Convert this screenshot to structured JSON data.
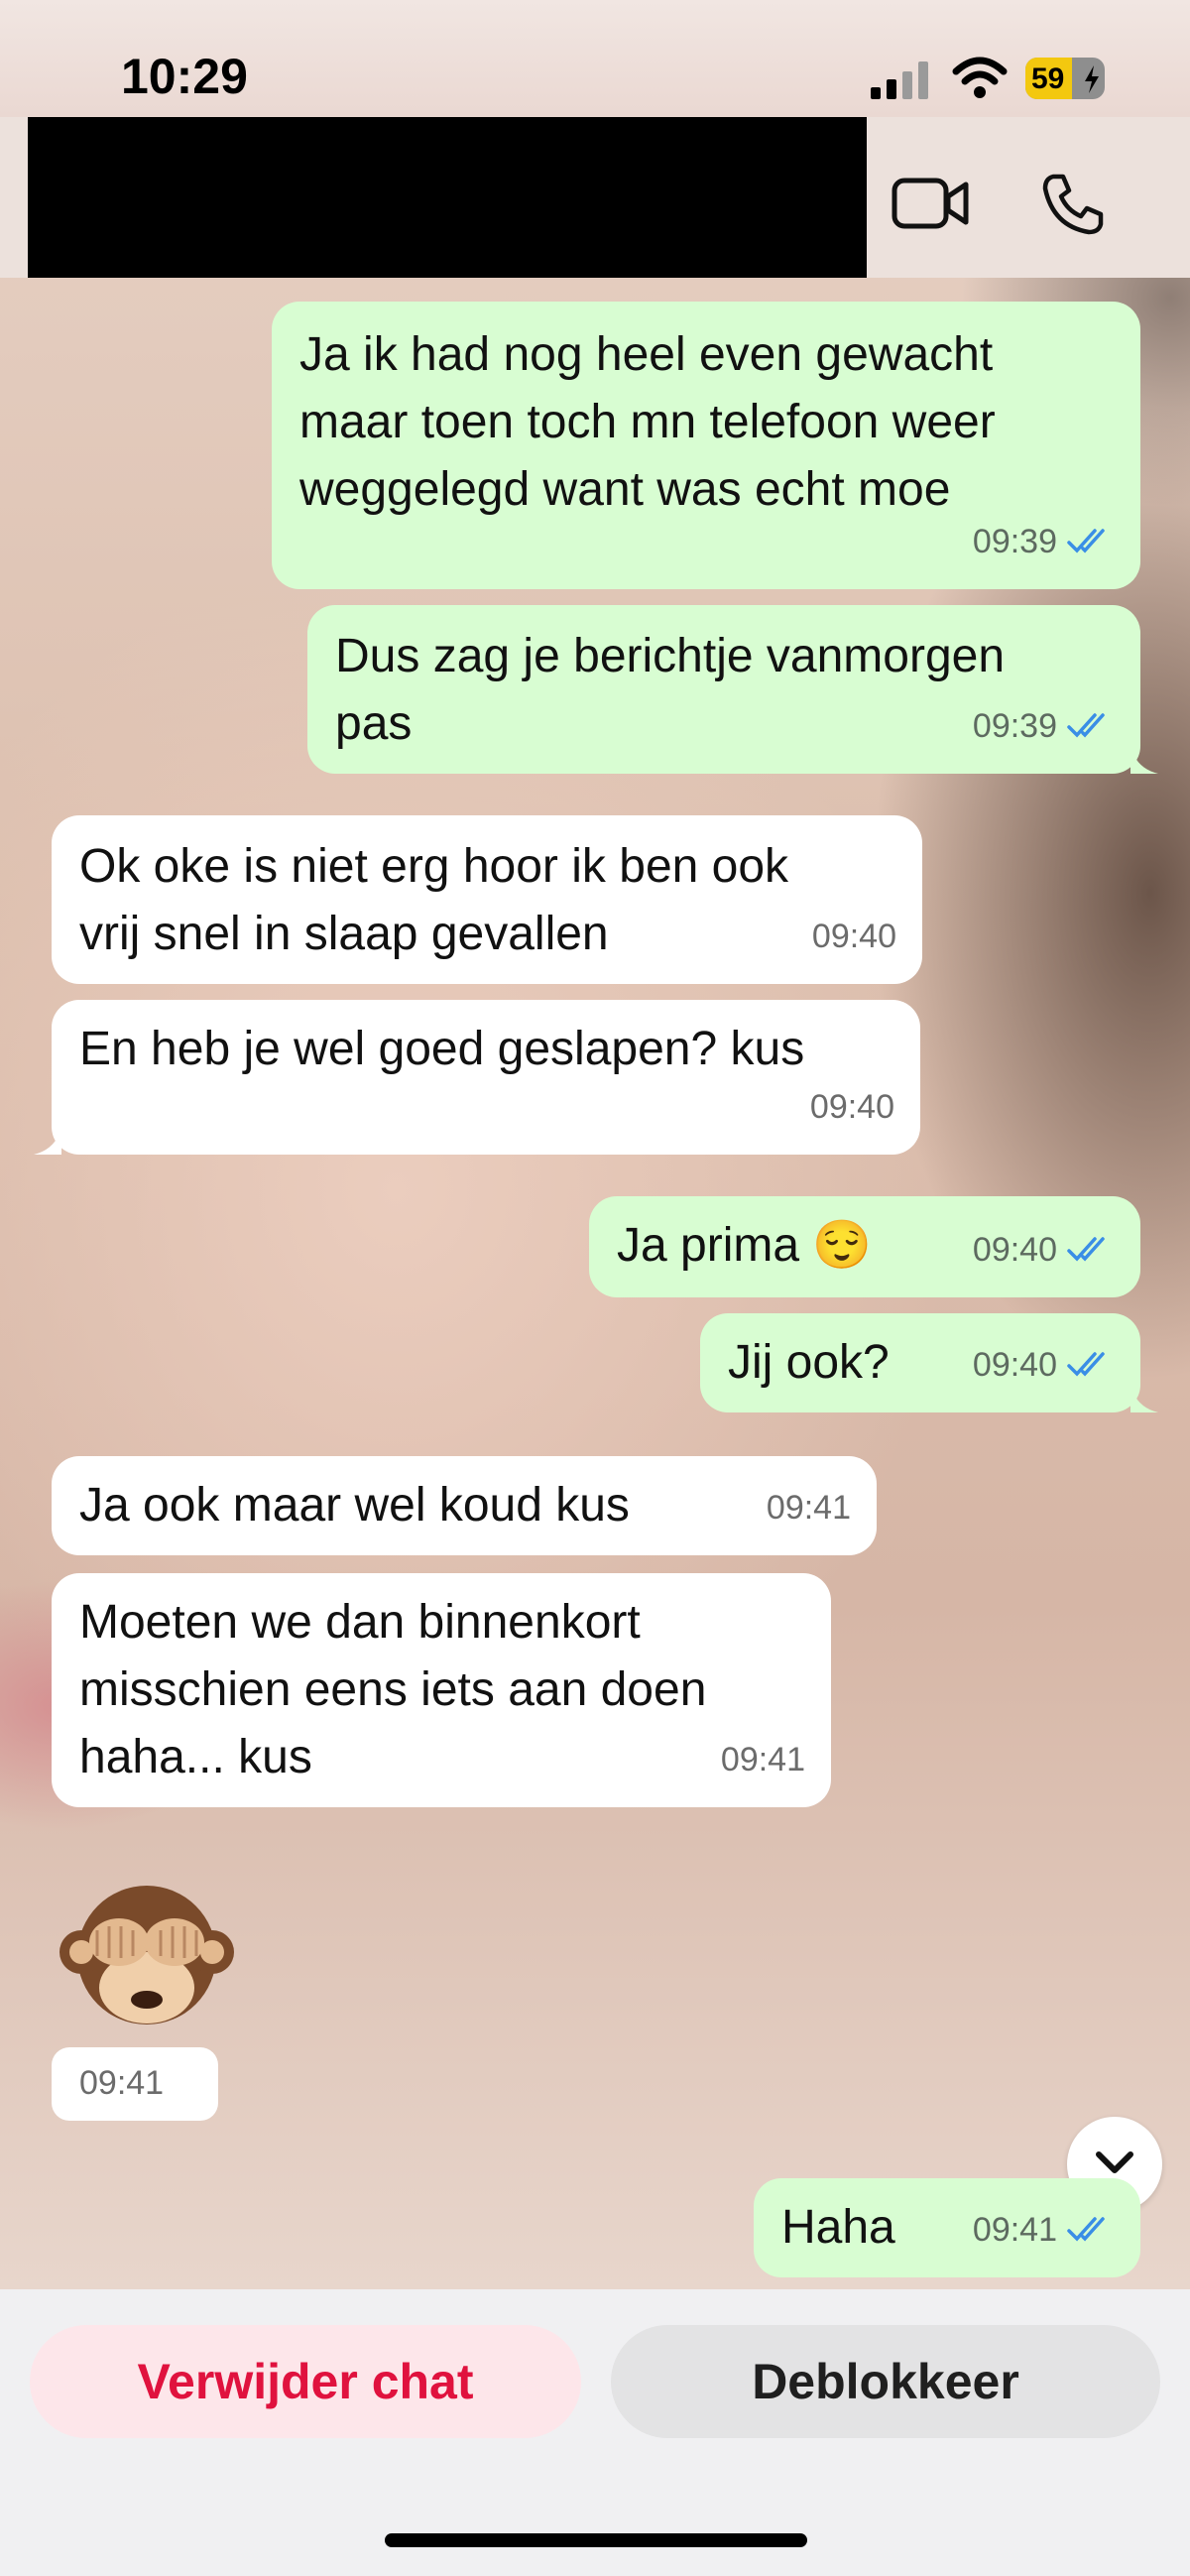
{
  "status_bar": {
    "time": "10:29",
    "battery": "59",
    "battery_level": 0.59
  },
  "header": {
    "contact_name": "",
    "video_call_icon": "video-camera-icon",
    "voice_call_icon": "phone-icon"
  },
  "messages": [
    {
      "direction": "out",
      "text": "Ja ik had nog heel even gewacht\nmaar toen toch mn telefoon weer\nweggelegd want was echt moe",
      "time": "09:39",
      "status": "read"
    },
    {
      "direction": "out",
      "text": "Dus zag je berichtje vanmorgen\npas",
      "time": "09:39",
      "status": "read"
    },
    {
      "direction": "in",
      "text": "Ok oke is niet erg hoor ik ben ook\nvrij snel in slaap gevallen",
      "time": "09:40"
    },
    {
      "direction": "in",
      "text": "En heb je wel goed geslapen? kus",
      "time": "09:40"
    },
    {
      "direction": "out",
      "text": "Ja prima 😌",
      "time": "09:40",
      "status": "read"
    },
    {
      "direction": "out",
      "text": "Jij ook?",
      "time": "09:40",
      "status": "read"
    },
    {
      "direction": "in",
      "text": "Ja ook maar wel koud kus",
      "time": "09:41"
    },
    {
      "direction": "in",
      "text": "Moeten we dan binnenkort\nmisschien eens iets aan doen\nhaha... kus",
      "time": "09:41"
    },
    {
      "direction": "in",
      "text": "🙈",
      "time": "09:41",
      "sticker": "see-no-evil-monkey"
    },
    {
      "direction": "out",
      "text": "Haha",
      "time": "09:41",
      "status": "read"
    }
  ],
  "actions": {
    "delete_chat": "Verwijder chat",
    "unblock": "Deblokkeer"
  },
  "colors": {
    "outgoing_bubble": "#d8fdd2",
    "incoming_bubble": "#ffffff",
    "delete_red": "#e0123e",
    "read_tick": "#3a8ee6"
  }
}
